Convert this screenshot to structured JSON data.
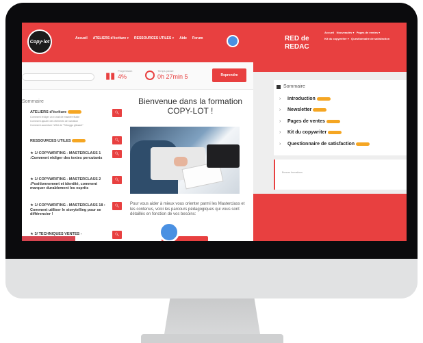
{
  "left_window": {
    "logo_text": "Copy·lot",
    "nav_items": [
      "Accueil",
      "ATELIERS d'écriture ▾",
      "RESSOURCES UTILES ▾",
      "Aide",
      "Forum"
    ],
    "stats": {
      "progress_label": "Progression",
      "progress_value": "4%",
      "time_label": "Temps passé",
      "time_value": "0h 27min 5",
      "button_label": "Reprendre"
    },
    "sommaire": {
      "title": "Sommaire",
      "items": [
        {
          "label": "ATELIERS d'écriture",
          "subs": [
            "Comment rédiger un e-mail de manière fluide",
            "Comment ajouter des éléments de narration",
            "Comment accentuer l'effet de \"Triboggo glissant\""
          ]
        },
        {
          "label": "RESSOURCES UTILES",
          "subs": []
        },
        {
          "label": "★ 1/ COPYWRITING - MASTERCLASS 1 :Comment rédiger des textes percutants",
          "subs": []
        },
        {
          "label": "★ 1/ COPYWRITING - MASTERCLASS 2 :Positionnement et identité, comment marquer durablement les esprits",
          "subs": []
        },
        {
          "label": "★ 1/ COPYWRITING - MASTERCLASS 18 : Comment utiliser le storytelling pour se différencier !",
          "subs": []
        },
        {
          "label": "★ 3/ TECHNIQUES VENTES -",
          "subs": []
        }
      ]
    },
    "welcome_title": "Bienvenue dans la formation COPY-LOT !",
    "intro_text": "Pour vous aider à mieux vous orienter parmi les Masterclass et les contenus, voici les parcours pédagogiques qui vous sont détaillés en fonction de vos besoins:"
  },
  "right_window": {
    "brand": "RED de REDAC",
    "nav_items": [
      "Accueil",
      "Nouveautés ▾",
      "Pages de ventes ▾",
      "Kit du copywriter ▾",
      "Questionnaire de satisfaction"
    ],
    "sommaire": {
      "title": "Sommaire",
      "items": [
        "Introduction",
        "Newsletter",
        "Pages de ventes",
        "Kit du copywriter",
        "Questionnaire de satisfaction"
      ]
    },
    "notes_label": "Bonnes formations"
  },
  "colors": {
    "brand_red": "#e84040",
    "badge_orange": "#f5a623",
    "accent_blue": "#4a90e2"
  }
}
